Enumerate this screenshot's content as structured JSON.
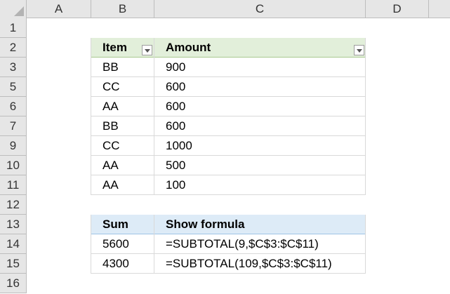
{
  "columns": [
    "A",
    "B",
    "C",
    "D"
  ],
  "rows": [
    "1",
    "2",
    "3",
    "5",
    "6",
    "7",
    "9",
    "10",
    "11",
    "12",
    "13",
    "14",
    "15",
    "16"
  ],
  "table1": {
    "headers": [
      "Item",
      "Amount"
    ],
    "header_fill": "#e2efda",
    "data": [
      [
        "BB",
        "900"
      ],
      [
        "CC",
        "600"
      ],
      [
        "AA",
        "600"
      ],
      [
        "BB",
        "600"
      ],
      [
        "CC",
        "1000"
      ],
      [
        "AA",
        "500"
      ],
      [
        "AA",
        "100"
      ]
    ]
  },
  "table2": {
    "headers": [
      "Sum",
      "Show formula"
    ],
    "header_fill": "#ddebf7",
    "data": [
      [
        "5600",
        "=SUBTOTAL(9,$C$3:$C$11)"
      ],
      [
        "4300",
        "=SUBTOTAL(109,$C$3:$C$11)"
      ]
    ]
  },
  "icons": {
    "filter": "filter-dropdown-icon",
    "select_all": "select-all-triangle-icon"
  }
}
